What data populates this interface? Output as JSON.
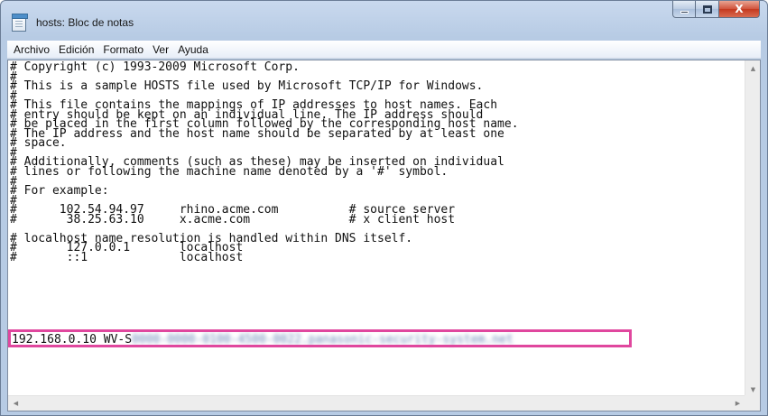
{
  "window": {
    "title": "hosts: Bloc de notas",
    "close_symbol": "X"
  },
  "menu": {
    "items": [
      "Archivo",
      "Edición",
      "Formato",
      "Ver",
      "Ayuda"
    ]
  },
  "document": {
    "lines": [
      "# Copyright (c) 1993-2009 Microsoft Corp.",
      "#",
      "# This is a sample HOSTS file used by Microsoft TCP/IP for Windows.",
      "#",
      "# This file contains the mappings of IP addresses to host names. Each",
      "# entry should be kept on an individual line. The IP address should",
      "# be placed in the first column followed by the corresponding host name.",
      "# The IP address and the host name should be separated by at least one",
      "# space.",
      "#",
      "# Additionally, comments (such as these) may be inserted on individual",
      "# lines or following the machine name denoted by a '#' symbol.",
      "#",
      "# For example:",
      "#",
      "#      102.54.94.97     rhino.acme.com          # source server",
      "#       38.25.63.10     x.acme.com              # x client host",
      "",
      "# localhost name resolution is handled within DNS itself.",
      "#       127.0.0.1       localhost",
      "#       ::1             localhost"
    ],
    "edited_line": {
      "prefix": "192.168.0.10 WV-S",
      "blurred_text": "0000-0000-0100-4500-0022.panasonic-security-system.net"
    }
  },
  "highlight_color": "#e0479e",
  "icons": [
    "notepad-icon",
    "minimize-icon",
    "maximize-icon",
    "close-icon",
    "scroll-up-icon",
    "scroll-down-icon",
    "scroll-left-icon",
    "scroll-right-icon"
  ]
}
